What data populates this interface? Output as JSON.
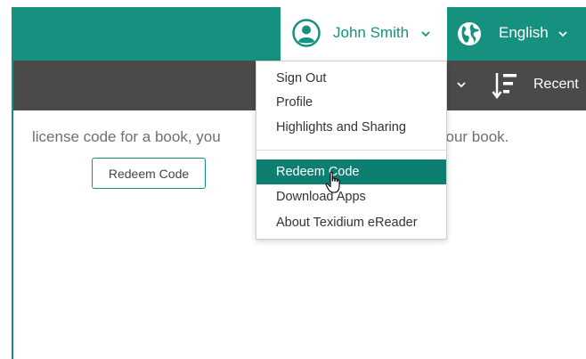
{
  "header": {
    "user": {
      "name": "John Smith",
      "icon": "user-circle-icon"
    },
    "language": {
      "label": "English",
      "icon": "globe-icon"
    }
  },
  "toolbar": {
    "sort": {
      "label": "Recent",
      "icon": "sort-descending-icon"
    }
  },
  "user_dropdown": {
    "items": [
      {
        "label": "Sign Out"
      },
      {
        "label": "Profile"
      },
      {
        "label": "Highlights and Sharing"
      },
      {
        "label": "Redeem Code",
        "active": true
      },
      {
        "label": "Download Apps"
      },
      {
        "label": "About Texidium eReader"
      }
    ]
  },
  "main": {
    "text_left": "license code for a book, you",
    "text_right": "your book.",
    "redeem_button": "Redeem Code"
  },
  "colors": {
    "brand_teal": "#16907f",
    "toolbar_gray": "#4a4a4a",
    "active_item": "#0d7f70"
  }
}
